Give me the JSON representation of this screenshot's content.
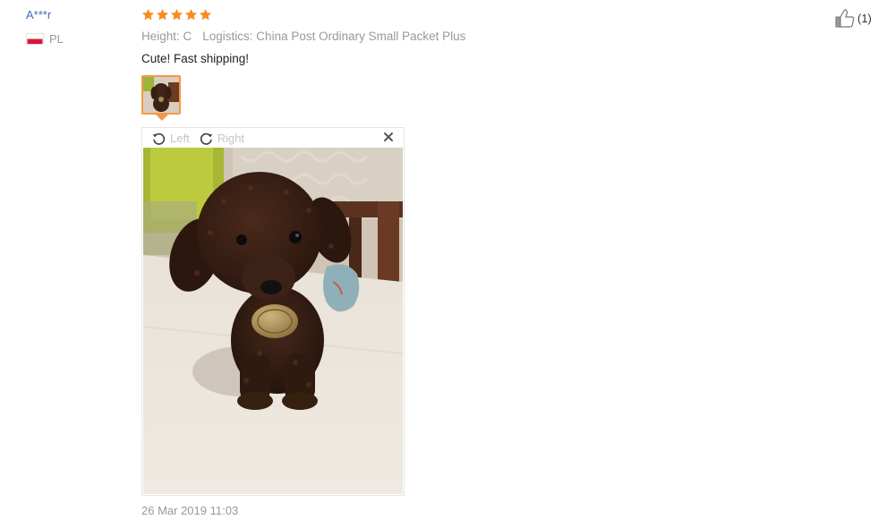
{
  "review": {
    "user": {
      "name": "A***r",
      "country_code": "PL"
    },
    "rating": 5,
    "stars": [
      "star",
      "star",
      "star",
      "star",
      "star"
    ],
    "attributes": {
      "height": "Height: C",
      "logistics": "Logistics: China Post Ordinary Small Packet Plus"
    },
    "text": "Cute! Fast shipping!",
    "viewer": {
      "rotate_left": "Left",
      "rotate_right": "Right"
    },
    "date": "26 Mar 2019 11:03",
    "helpful_count": "(1)"
  },
  "colors": {
    "star": "#f78c1e",
    "user_link": "#3a6fc4",
    "thumb_border": "#f39a4a",
    "muted_text": "#999999"
  },
  "icons": {
    "rotate_left": "rotate-left-icon",
    "rotate_right": "rotate-right-icon",
    "close": "close-icon",
    "like": "thumbs-up-icon",
    "flag": "poland-flag-icon"
  }
}
